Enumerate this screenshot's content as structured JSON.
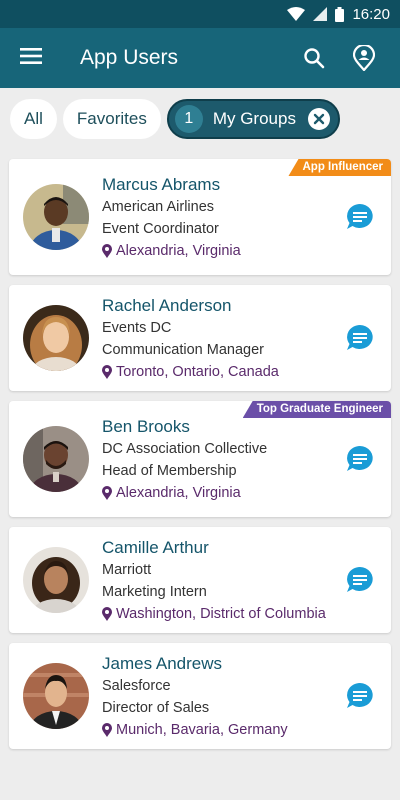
{
  "status": {
    "time": "16:20"
  },
  "app_bar": {
    "title": "App Users"
  },
  "filters": {
    "all": "All",
    "favorites": "Favorites",
    "groups_count": "1",
    "groups": "My Groups"
  },
  "users": [
    {
      "name": "Marcus Abrams",
      "company": "American Airlines",
      "title": "Event Coordinator",
      "location": "Alexandria, Virginia",
      "badge": "App Influencer",
      "badge_color": "#f28c18"
    },
    {
      "name": "Rachel Anderson",
      "company": "Events DC",
      "title": "Communication Manager",
      "location": "Toronto, Ontario, Canada"
    },
    {
      "name": "Ben Brooks",
      "company": "DC Association Collective",
      "title": "Head of Membership",
      "location": "Alexandria, Virginia",
      "badge": "Top Graduate Engineer",
      "badge_color": "#6b4fa8"
    },
    {
      "name": "Camille Arthur",
      "company": "Marriott",
      "title": "Marketing Intern",
      "location": "Washington, District of Columbia"
    },
    {
      "name": "James Andrews",
      "company": "Salesforce",
      "title": "Director of Sales",
      "location": "Munich, Bavaria, Germany"
    }
  ],
  "colors": {
    "header": "#176579",
    "status_bar": "#0f4f60",
    "chat": "#1a9cd6",
    "location": "#5a2a6b"
  }
}
